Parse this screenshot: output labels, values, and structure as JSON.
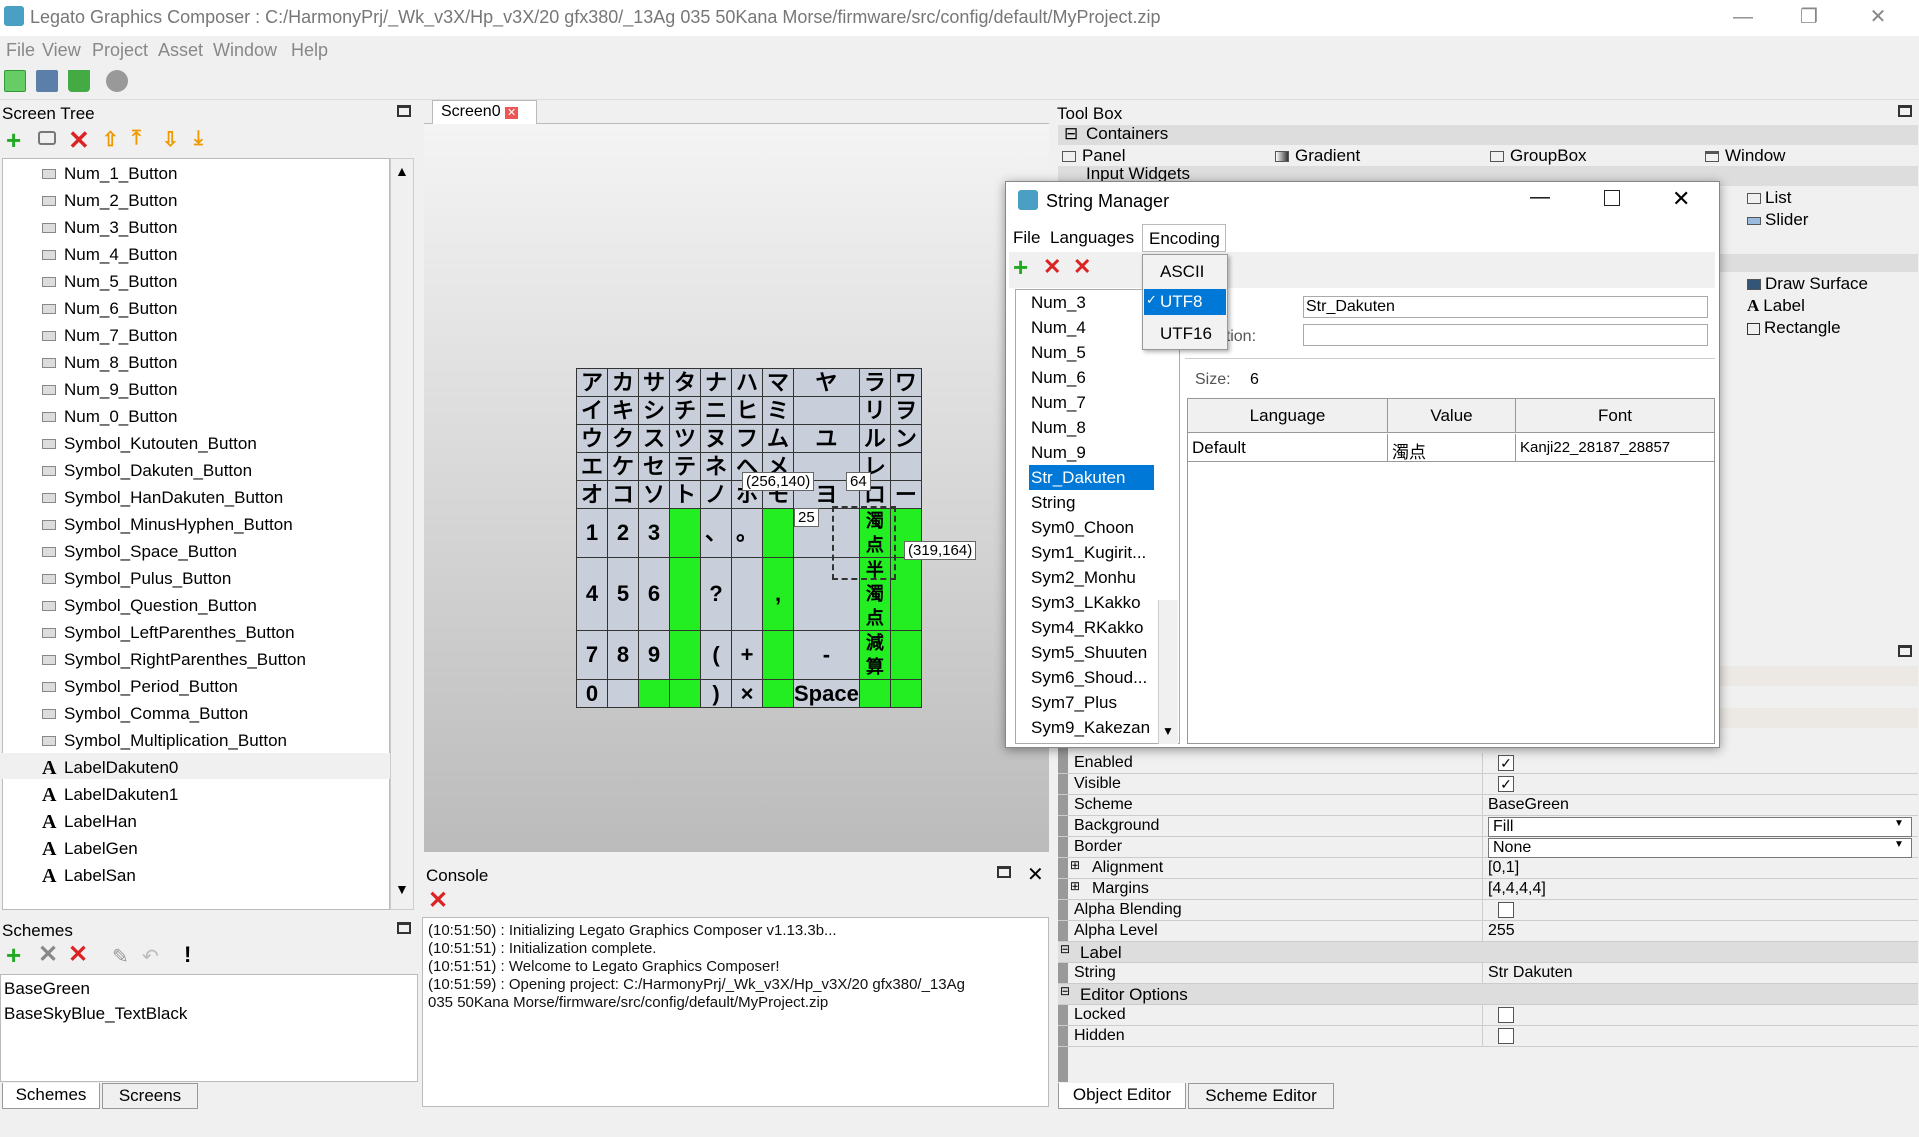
{
  "window": {
    "title": "Legato Graphics Composer : C:/HarmonyPrj/_Wk_v3X/Hp_v3X/20 gfx380/_13Ag 035 50Kana Morse/firmware/src/config/default/MyProject.zip",
    "min": "—",
    "max": "❐",
    "close": "✕"
  },
  "menu": [
    "File",
    "View",
    "Project",
    "Asset",
    "Window",
    "Help"
  ],
  "screenTree": {
    "title": "Screen Tree",
    "items": [
      "Num_1_Button",
      "Num_2_Button",
      "Num_3_Button",
      "Num_4_Button",
      "Num_5_Button",
      "Num_6_Button",
      "Num_7_Button",
      "Num_8_Button",
      "Num_9_Button",
      "Num_0_Button",
      "Symbol_Kutouten_Button",
      "Symbol_Dakuten_Button",
      "Symbol_HanDakuten_Button",
      "Symbol_MinusHyphen_Button",
      "Symbol_Space_Button",
      "Symbol_Pulus_Button",
      "Symbol_Question_Button",
      "Symbol_LeftParenthes_Button",
      "Symbol_RightParenthes_Button",
      "Symbol_Period_Button",
      "Symbol_Comma_Button",
      "Symbol_Multiplication_Button",
      "LabelDakuten0",
      "LabelDakuten1",
      "LabelHan",
      "LabelGen",
      "LabelSan"
    ],
    "label_start_index": 22
  },
  "schemes": {
    "title": "Schemes",
    "items": [
      "BaseGreen",
      "BaseSkyBlue_TextBlack"
    ],
    "tabs": [
      "Schemes",
      "Screens"
    ]
  },
  "screenTab": "Screen0",
  "keyboard": {
    "rows": [
      [
        "ア",
        "カ",
        "サ",
        "タ",
        "ナ",
        "ハ",
        "マ",
        "ヤ",
        "ラ",
        "ワ"
      ],
      [
        "イ",
        "キ",
        "シ",
        "チ",
        "ニ",
        "ヒ",
        "ミ",
        "",
        "リ",
        "ヲ"
      ],
      [
        "ウ",
        "ク",
        "ス",
        "ツ",
        "ヌ",
        "フ",
        "ム",
        "ユ",
        "ル",
        "ン"
      ],
      [
        "エ",
        "ケ",
        "セ",
        "テ",
        "ネ",
        "ヘ",
        "メ",
        "",
        "レ",
        ""
      ],
      [
        "オ",
        "コ",
        "ソ",
        "ト",
        "ノ",
        "ホ",
        "モ",
        "ヨ",
        "ロ",
        "ー"
      ],
      [
        "1",
        "2",
        "3",
        "",
        "、",
        "。",
        "",
        "",
        "濁点",
        ""
      ],
      [
        "4",
        "5",
        "6",
        "",
        "?",
        "",
        ",",
        "",
        "半濁点",
        ""
      ],
      [
        "7",
        "8",
        "9",
        "",
        "(",
        "+",
        "",
        "-",
        "減算",
        ""
      ],
      [
        "0",
        "",
        "",
        " ",
        ")",
        "×",
        "",
        "Space",
        "",
        ""
      ]
    ],
    "tooltip1": "(256,140)",
    "tooltip2": "64",
    "tooltip3": "25",
    "tooltip4": "(319,164)"
  },
  "console": {
    "title": "Console",
    "lines": [
      "(10:51:50) : Initializing Legato Graphics Composer v1.13.3b...",
      "(10:51:51) : Initialization complete.",
      "(10:51:51) : Welcome to Legato Graphics Composer!",
      "(10:51:59) : Opening project: C:/HarmonyPrj/_Wk_v3X/Hp_v3X/20 gfx380/_13Ag",
      "035 50Kana Morse/firmware/src/config/default/MyProject.zip"
    ]
  },
  "toolbox": {
    "title": "Tool Box",
    "sections": [
      "Containers",
      "Input Widgets"
    ],
    "items": [
      "Panel",
      "Gradient",
      "GroupBox",
      "Window",
      "List",
      "Slider",
      "Draw Surface",
      "Label",
      "Rectangle"
    ]
  },
  "properties": {
    "rows": [
      {
        "label": "Enabled",
        "value": "",
        "type": "check",
        "checked": true
      },
      {
        "label": "Visible",
        "value": "",
        "type": "check",
        "checked": true
      },
      {
        "label": "Scheme",
        "value": "BaseGreen",
        "type": "text"
      },
      {
        "label": "Background",
        "value": "Fill",
        "type": "combo"
      },
      {
        "label": "Border",
        "value": "None",
        "type": "combo"
      },
      {
        "label": "Alignment",
        "value": "[0,1]",
        "type": "text",
        "expand": true
      },
      {
        "label": "Margins",
        "value": "[4,4,4,4]",
        "type": "text",
        "expand": true
      },
      {
        "label": "Alpha Blending",
        "value": "",
        "type": "check",
        "checked": false
      },
      {
        "label": "Alpha Level",
        "value": "255",
        "type": "text"
      },
      {
        "label": "Label",
        "value": "",
        "type": "section"
      },
      {
        "label": "String",
        "value": "Str Dakuten",
        "type": "text"
      },
      {
        "label": "Editor Options",
        "value": "",
        "type": "section"
      },
      {
        "label": "Locked",
        "value": "",
        "type": "check",
        "checked": false
      },
      {
        "label": "Hidden",
        "value": "",
        "type": "check",
        "checked": false
      }
    ],
    "tabs": [
      "Object Editor",
      "Scheme Editor"
    ]
  },
  "stringManager": {
    "title": "String Manager",
    "menu": [
      "File",
      "Languages",
      "Encoding"
    ],
    "encodingOptions": [
      "ASCII",
      "UTF8",
      "UTF16"
    ],
    "selectedEncoding": "UTF8",
    "list": [
      "Num_3",
      "Num_4",
      "Num_5",
      "Num_6",
      "Num_7",
      "Num_8",
      "Num_9",
      "Str_Dakuten",
      "String",
      "Sym0_Choon",
      "Sym1_Kugirit...",
      "Sym2_Monhu",
      "Sym3_LKakko",
      "Sym4_RKakko",
      "Sym5_Shuuten",
      "Sym6_Shoud...",
      "Sym7_Plus",
      "Sym9_Kakezan"
    ],
    "selected": "Str_Dakuten",
    "nameLabel": "e:",
    "nameValue": "Str_Dakuten",
    "descLabel": "cription:",
    "descValue": "",
    "sizeLabel": "Size:",
    "sizeValue": "6",
    "table": {
      "headers": [
        "Language",
        "Value",
        "Font"
      ],
      "rows": [
        [
          "Default",
          "濁点",
          "Kanji22_28187_28857"
        ]
      ]
    }
  }
}
